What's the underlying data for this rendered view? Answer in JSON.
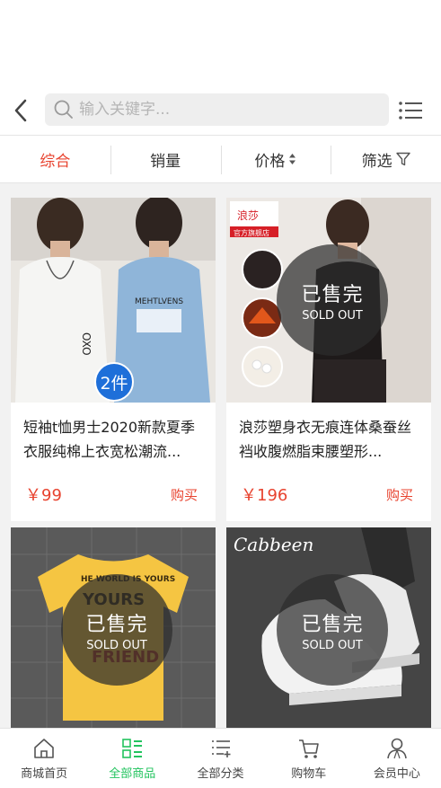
{
  "search": {
    "placeholder": "输入关键字..."
  },
  "sort": {
    "tabs": [
      {
        "label": "综合",
        "active": true
      },
      {
        "label": "销量",
        "active": false
      },
      {
        "label": "价格",
        "active": false
      },
      {
        "label": "筛选",
        "active": false
      }
    ]
  },
  "sold_out": {
    "cn": "已售完",
    "en": "SOLD OUT"
  },
  "products": [
    {
      "title": "短袖t恤男士2020新款夏季衣服纯棉上衣宽松潮流...",
      "price": "￥99",
      "buy": "购买",
      "badge": "2件",
      "sold_out": false,
      "image_text": "MEHTLVENS"
    },
    {
      "title": "浪莎塑身衣无痕连体桑蚕丝裆收腹燃脂束腰塑形...",
      "price": "￥196",
      "buy": "购买",
      "sold_out": true,
      "brand": "浪莎",
      "shop": "官方旗舰店"
    },
    {
      "title": "",
      "price": "",
      "buy": "",
      "sold_out": true,
      "image_text": "HE WORLD IS YOURS"
    },
    {
      "title": "",
      "price": "",
      "buy": "",
      "sold_out": true,
      "image_text": "Cabbeen"
    }
  ],
  "tabbar": [
    {
      "label": "商城首页",
      "icon": "home-icon",
      "active": false
    },
    {
      "label": "全部商品",
      "icon": "grid-icon",
      "active": true
    },
    {
      "label": "全部分类",
      "icon": "category-list-icon",
      "active": false
    },
    {
      "label": "购物车",
      "icon": "cart-icon",
      "active": false
    },
    {
      "label": "会员中心",
      "icon": "user-icon",
      "active": false
    }
  ],
  "colors": {
    "accent": "#e8432f",
    "tab_active": "#22c35e",
    "badge": "#1e6fd9"
  }
}
